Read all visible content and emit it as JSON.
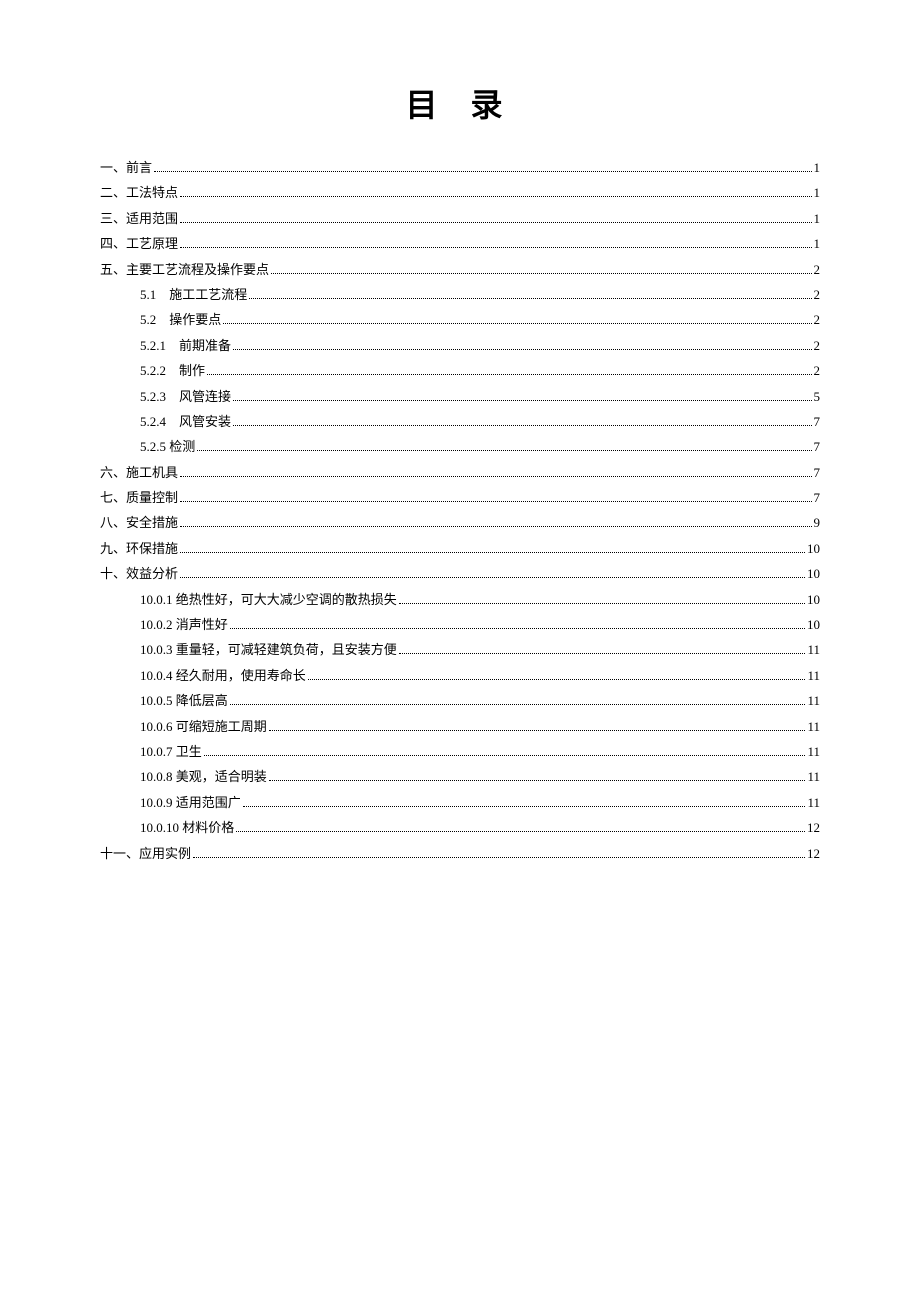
{
  "title": "目 录",
  "toc": [
    {
      "level": 0,
      "label": "一、前言",
      "page": "1"
    },
    {
      "level": 0,
      "label": "二、工法特点",
      "page": "1"
    },
    {
      "level": 0,
      "label": "三、适用范围",
      "page": "1"
    },
    {
      "level": 0,
      "label": "四、工艺原理",
      "page": "1"
    },
    {
      "level": 0,
      "label": "五、主要工艺流程及操作要点",
      "page": "2"
    },
    {
      "level": 1,
      "label": "5.1　施工工艺流程",
      "page": "2"
    },
    {
      "level": 1,
      "label": "5.2　操作要点",
      "page": "2"
    },
    {
      "level": 1,
      "label": "5.2.1　前期准备",
      "page": "2"
    },
    {
      "level": 1,
      "label": "5.2.2　制作",
      "page": "2"
    },
    {
      "level": 1,
      "label": "5.2.3　风管连接",
      "page": "5"
    },
    {
      "level": 1,
      "label": "5.2.4　风管安装",
      "page": "7"
    },
    {
      "level": 1,
      "label": "5.2.5  检测",
      "page": "7"
    },
    {
      "level": 0,
      "label": "六、施工机具",
      "page": "7"
    },
    {
      "level": 0,
      "label": "七、质量控制",
      "page": "7"
    },
    {
      "level": 0,
      "label": "八、安全措施",
      "page": "9"
    },
    {
      "level": 0,
      "label": "九、环保措施",
      "page": "10"
    },
    {
      "level": 0,
      "label": "十、效益分析",
      "page": "10"
    },
    {
      "level": 1,
      "label": "10.0.1  绝热性好，可大大减少空调的散热损失",
      "page": "10"
    },
    {
      "level": 1,
      "label": "10.0.2  消声性好",
      "page": "10"
    },
    {
      "level": 1,
      "label": "10.0.3  重量轻，可减轻建筑负荷，且安装方便",
      "page": "11"
    },
    {
      "level": 1,
      "label": "10.0.4  经久耐用，使用寿命长",
      "page": "11"
    },
    {
      "level": 1,
      "label": "10.0.5  降低层高",
      "page": "11"
    },
    {
      "level": 1,
      "label": "10.0.6  可缩短施工周期",
      "page": "11"
    },
    {
      "level": 1,
      "label": "10.0.7  卫生",
      "page": "11"
    },
    {
      "level": 1,
      "label": "10.0.8  美观，适合明装",
      "page": "11"
    },
    {
      "level": 1,
      "label": "10.0.9  适用范围广",
      "page": "11"
    },
    {
      "level": 1,
      "label": "10.0.10  材料价格",
      "page": "12"
    },
    {
      "level": 0,
      "label": "十一、应用实例",
      "page": "12"
    }
  ]
}
